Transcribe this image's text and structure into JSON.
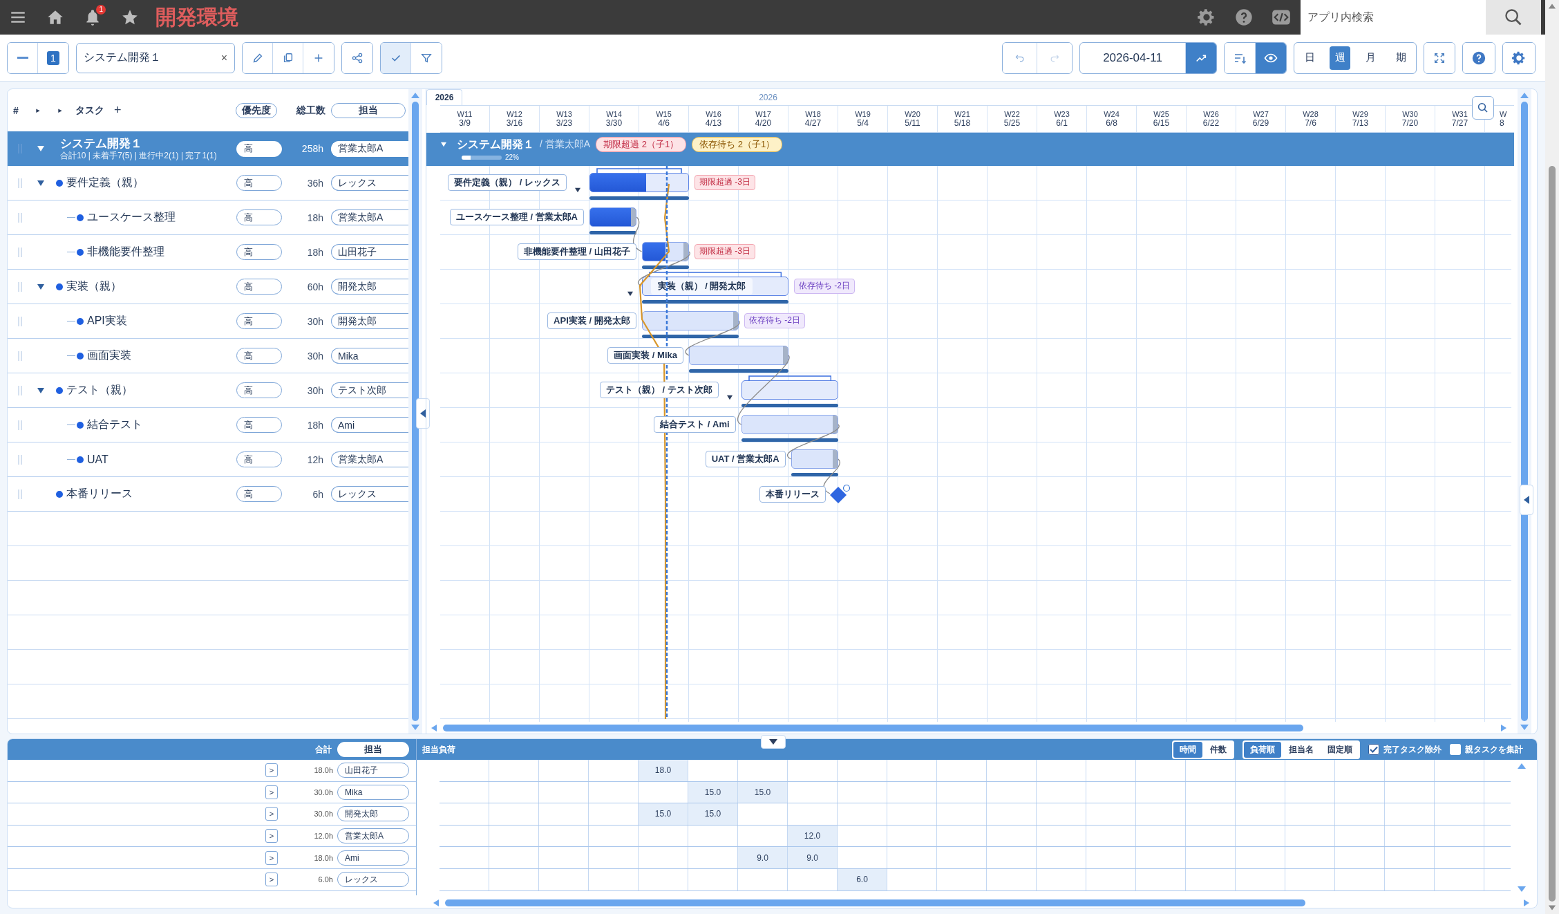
{
  "topbar": {
    "title": "開発環境",
    "notification_count": "1",
    "search": {
      "placeholder": "アプリ内検索"
    }
  },
  "toolbar": {
    "level_badge": "1",
    "project_select": {
      "value": "システム開発１",
      "clear": "×"
    },
    "toggles": [
      {
        "kind": "check",
        "on": true
      },
      {
        "kind": "filter",
        "on": false
      }
    ],
    "date": "2026-04-11",
    "visibility_on": true,
    "views": [
      {
        "label": "日",
        "selected": false
      },
      {
        "label": "週",
        "selected": true
      },
      {
        "label": "月",
        "selected": false
      },
      {
        "label": "期",
        "selected": false
      }
    ]
  },
  "tree": {
    "header": {
      "number": "#",
      "expand_all": "▸",
      "expand_level": "▸",
      "task": "タスク",
      "add": "+",
      "priority": "優先度",
      "hours": "総工数",
      "assignee": "担当"
    },
    "project": {
      "title": "システム開発１",
      "summary": "合計10 | 未着手7(5) | 進行中2(1) | 完了1(1)",
      "expanded": true,
      "priority": "高",
      "hours": "258h",
      "assignee": "営業太郎A"
    },
    "tasks": [
      {
        "name": "要件定義（親）",
        "priority": "高",
        "hours": "36h",
        "assignee": "レックス",
        "expanded": true,
        "children": [
          {
            "name": "ユースケース整理",
            "priority": "高",
            "hours": "18h",
            "assignee": "営業太郎A"
          },
          {
            "name": "非機能要件整理",
            "priority": "高",
            "hours": "18h",
            "assignee": "山田花子"
          }
        ]
      },
      {
        "name": "実装（親）",
        "priority": "高",
        "hours": "60h",
        "assignee": "開発太郎",
        "expanded": true,
        "children": [
          {
            "name": "API実装",
            "priority": "高",
            "hours": "30h",
            "assignee": "開発太郎"
          },
          {
            "name": "画面実装",
            "priority": "高",
            "hours": "30h",
            "assignee": "Mika"
          }
        ]
      },
      {
        "name": "テスト（親）",
        "priority": "高",
        "hours": "30h",
        "assignee": "テスト次郎",
        "expanded": true,
        "children": [
          {
            "name": "結合テスト",
            "priority": "高",
            "hours": "18h",
            "assignee": "Ami"
          },
          {
            "name": "UAT",
            "priority": "高",
            "hours": "12h",
            "assignee": "営業太郎A"
          }
        ]
      },
      {
        "name": "本番リリース",
        "priority": "高",
        "hours": "6h",
        "assignee": "レックス"
      }
    ]
  },
  "gantt": {
    "year_tab": "2026",
    "year": "2026",
    "weeks": [
      {
        "week": "W11",
        "date": "3/9"
      },
      {
        "week": "W12",
        "date": "3/16"
      },
      {
        "week": "W13",
        "date": "3/23"
      },
      {
        "week": "W14",
        "date": "3/30"
      },
      {
        "week": "W15",
        "date": "4/6"
      },
      {
        "week": "W16",
        "date": "4/13"
      },
      {
        "week": "W17",
        "date": "4/20"
      },
      {
        "week": "W18",
        "date": "4/27"
      },
      {
        "week": "W19",
        "date": "5/4"
      },
      {
        "week": "W20",
        "date": "5/11"
      },
      {
        "week": "W21",
        "date": "5/18"
      },
      {
        "week": "W22",
        "date": "5/25"
      },
      {
        "week": "W23",
        "date": "6/1"
      },
      {
        "week": "W24",
        "date": "6/8"
      },
      {
        "week": "W25",
        "date": "6/15"
      },
      {
        "week": "W26",
        "date": "6/22"
      },
      {
        "week": "W27",
        "date": "6/29"
      },
      {
        "week": "W28",
        "date": "7/6"
      },
      {
        "week": "W29",
        "date": "7/13"
      },
      {
        "week": "W30",
        "date": "7/20"
      },
      {
        "week": "W31",
        "date": "7/27"
      },
      {
        "week": "W",
        "date": "8"
      }
    ],
    "project": {
      "title": "システム開発１",
      "owner": "/ 営業太郎A",
      "expanded": true,
      "badges": [
        {
          "text": "期限超過 2（子1）",
          "kind": "overdue"
        },
        {
          "text": "依存待ち 2（子1）",
          "kind": "waiting"
        }
      ],
      "level": 0.22,
      "percent": "22%"
    },
    "rows": [
      {
        "kind": "parent",
        "label": "要件定義（親） / レックス",
        "label_inside": false,
        "level": 0.57,
        "badge": {
          "text": "期限超過 -3日",
          "kind": "overdue"
        }
      },
      {
        "kind": "task",
        "label": "ユースケース整理 / 営業太郎A",
        "label_inside": false,
        "level": 1
      },
      {
        "kind": "task",
        "label": "非機能要件整理 / 山田花子",
        "label_inside": false,
        "level": 0.5,
        "badge": {
          "text": "期限超過 -3日",
          "kind": "overdue"
        }
      },
      {
        "kind": "parent",
        "label": "実装（親） / 開発太郎",
        "label_inside": true,
        "level": 0,
        "badge": {
          "text": "依存待ち -2日",
          "kind": "waiting"
        }
      },
      {
        "kind": "task",
        "label": "API実装 / 開発太郎",
        "label_inside": false,
        "level": 0,
        "badge": {
          "text": "依存待ち -2日",
          "kind": "waiting"
        }
      },
      {
        "kind": "task",
        "label": "画面実装 / Mika",
        "label_inside": false,
        "level": 0
      },
      {
        "kind": "parent",
        "label": "テスト（親） / テスト次郎",
        "label_inside": false,
        "level": 0
      },
      {
        "kind": "task",
        "label": "結合テスト / Ami",
        "label_inside": false,
        "level": 0
      },
      {
        "kind": "task",
        "label": "UAT / 営業太郎A",
        "label_inside": false,
        "level": 0
      },
      {
        "kind": "milestone",
        "label": "本番リリース"
      }
    ]
  },
  "load_panel": {
    "total_label": "合計",
    "assignee_label": "担当",
    "title": "担当負荷",
    "units": [
      {
        "label": "時間",
        "selected": true
      },
      {
        "label": "件数",
        "selected": false
      }
    ],
    "sorts": [
      {
        "label": "負荷順",
        "selected": true
      },
      {
        "label": "担当名",
        "selected": false
      },
      {
        "label": "固定順",
        "selected": false
      }
    ],
    "options": [
      {
        "label": "完了タスク除外",
        "checked": true
      },
      {
        "label": "親タスクを集計",
        "checked": false
      }
    ],
    "rows": [
      {
        "expand": ">",
        "hours": "18.0h",
        "assignee": "山田花子",
        "cells": [
          null,
          null,
          null,
          null,
          "18.0"
        ]
      },
      {
        "expand": ">",
        "hours": "30.0h",
        "assignee": "Mika",
        "cells": [
          null,
          null,
          null,
          null,
          null,
          "15.0",
          "15.0"
        ]
      },
      {
        "expand": ">",
        "hours": "30.0h",
        "assignee": "開発太郎",
        "cells": [
          null,
          null,
          null,
          null,
          "15.0",
          "15.0"
        ]
      },
      {
        "expand": ">",
        "hours": "12.0h",
        "assignee": "営業太郎A",
        "cells": [
          null,
          null,
          null,
          null,
          null,
          null,
          null,
          "12.0"
        ]
      },
      {
        "expand": ">",
        "hours": "18.0h",
        "assignee": "Ami",
        "cells": [
          null,
          null,
          null,
          null,
          null,
          null,
          "9.0",
          "9.0"
        ]
      },
      {
        "expand": ">",
        "hours": "6.0h",
        "assignee": "レックス",
        "cells": [
          null,
          null,
          null,
          null,
          null,
          null,
          null,
          null,
          "6.0"
        ]
      }
    ]
  }
}
